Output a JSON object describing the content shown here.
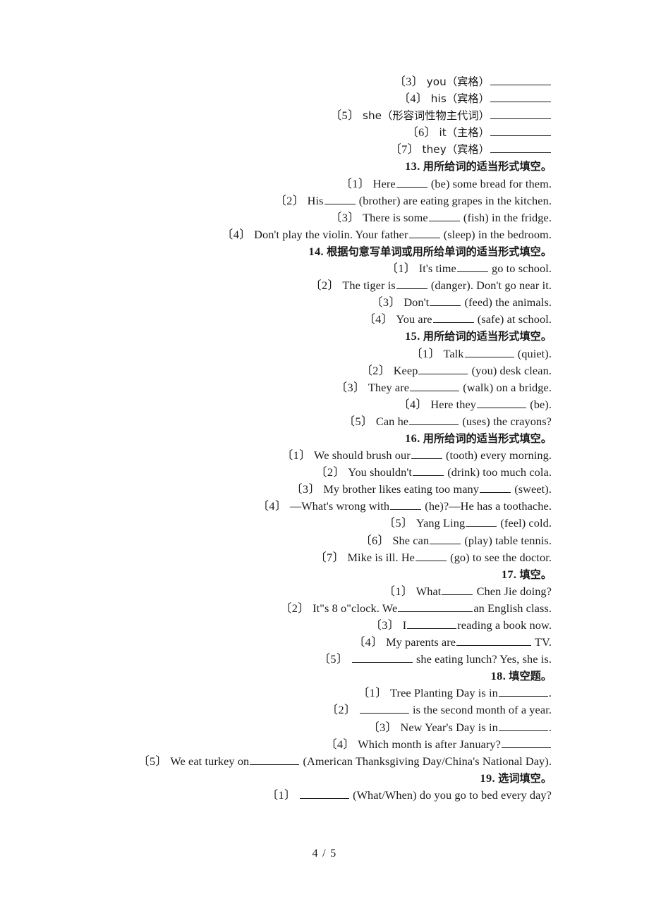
{
  "document": {
    "page_label": "4 / 5",
    "page_current": 4,
    "page_total": 5
  },
  "carryover": {
    "items": [
      {
        "num": "〔3〕",
        "text": "you（宾格）"
      },
      {
        "num": "〔4〕",
        "text": "his（宾格）"
      },
      {
        "num": "〔5〕",
        "text": "she（形容词性物主代词）"
      },
      {
        "num": "〔6〕",
        "text": "it（主格）"
      },
      {
        "num": "〔7〕",
        "text": "they（宾格）"
      }
    ]
  },
  "sections": [
    {
      "number": "13.",
      "title": "用所给词的适当形式填空。",
      "items": [
        {
          "num": "〔1〕",
          "pre": "Here",
          "post": "(be) some bread for them."
        },
        {
          "num": "〔2〕",
          "pre": "His",
          "post": "(brother) are eating grapes in the kitchen."
        },
        {
          "num": "〔3〕",
          "pre": "There is some",
          "post": "(fish) in the fridge."
        },
        {
          "num": "〔4〕",
          "pre": "Don't play the violin. Your father",
          "post": "(sleep) in the bedroom."
        }
      ]
    },
    {
      "number": "14.",
      "title": "根据句意写单词或用所给单词的适当形式填空。",
      "items": [
        {
          "num": "〔1〕",
          "pre": "It's time",
          "post": "go to school."
        },
        {
          "num": "〔2〕",
          "pre": "The tiger is",
          "post": "(danger). Don't go near it."
        },
        {
          "num": "〔3〕",
          "pre": "Don't",
          "post": "(feed) the animals."
        },
        {
          "num": "〔4〕",
          "pre": "You are",
          "post": "(safe) at school."
        }
      ]
    },
    {
      "number": "15.",
      "title": "用所给词的适当形式填空。",
      "items": [
        {
          "num": "〔1〕",
          "pre": "Talk",
          "post": "(quiet)."
        },
        {
          "num": "〔2〕",
          "pre": "Keep",
          "post": "(you) desk clean."
        },
        {
          "num": "〔3〕",
          "pre": "They are",
          "post": "(walk) on a bridge."
        },
        {
          "num": "〔4〕",
          "pre": "Here they",
          "post": "(be)."
        },
        {
          "num": "〔5〕",
          "pre": "Can he",
          "post": "(uses) the crayons?"
        }
      ]
    },
    {
      "number": "16.",
      "title": "用所给词的适当形式填空。",
      "items": [
        {
          "num": "〔1〕",
          "pre": "We should brush our",
          "post": "(tooth) every morning."
        },
        {
          "num": "〔2〕",
          "pre": "You shouldn't",
          "post": "(drink) too much cola."
        },
        {
          "num": "〔3〕",
          "pre": "My brother likes eating too many",
          "post": "(sweet)."
        },
        {
          "num": "〔4〕",
          "pre": "—What's wrong with",
          "post": "(he)?—He has a toothache."
        },
        {
          "num": "〔5〕",
          "pre": "Yang Ling",
          "post": "(feel) cold."
        },
        {
          "num": "〔6〕",
          "pre": "She can",
          "post": "(play) table tennis."
        },
        {
          "num": "〔7〕",
          "pre": "Mike is ill. He",
          "post": "(go) to see the doctor."
        }
      ]
    },
    {
      "number": "17.",
      "title": "填空。",
      "items": [
        {
          "num": "〔1〕",
          "pre": "What",
          "post": "Chen Jie doing?"
        },
        {
          "num": "〔2〕",
          "pre": "It\"s 8 o\"clock. We",
          "post": "an English class."
        },
        {
          "num": "〔3〕",
          "pre": "I",
          "post": "reading a book now."
        },
        {
          "num": "〔4〕",
          "pre": "My parents are",
          "post": "TV."
        },
        {
          "num": "〔5〕",
          "pre": "",
          "post": "she eating lunch? Yes, she is."
        }
      ]
    },
    {
      "number": "18.",
      "title": "填空题。",
      "items": [
        {
          "num": "〔1〕",
          "pre": "Tree Planting Day is in",
          "post": "."
        },
        {
          "num": "〔2〕",
          "pre": "",
          "post": "is the second month of a year."
        },
        {
          "num": "〔3〕",
          "pre": "New Year's Day is in",
          "post": "."
        },
        {
          "num": "〔4〕",
          "pre": "Which month is after January?",
          "post": ""
        },
        {
          "num": "〔5〕",
          "pre": "We eat turkey on",
          "post": "(American Thanksgiving Day/China's National Day)."
        }
      ]
    },
    {
      "number": "19.",
      "title": "选词填空。",
      "items": [
        {
          "num": "〔1〕",
          "pre": "",
          "post": "(What/When) do you go to bed every day?"
        }
      ]
    }
  ]
}
